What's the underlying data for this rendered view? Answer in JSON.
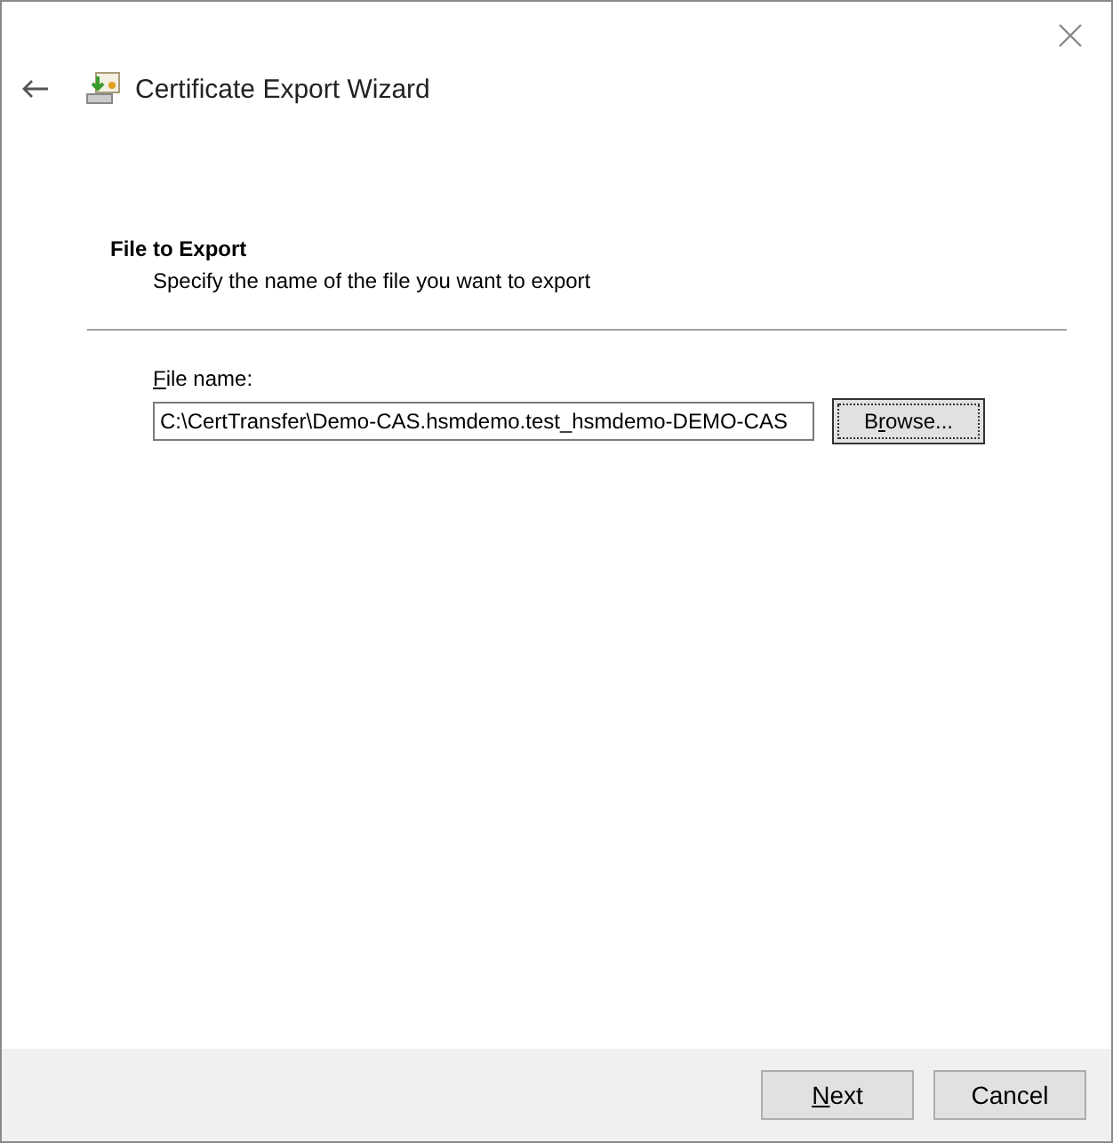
{
  "window": {
    "title": "Certificate Export Wizard"
  },
  "page": {
    "heading": "File to Export",
    "description": "Specify the name of the file you want to export"
  },
  "file_name": {
    "access_key": "F",
    "label_rest": "ile name:",
    "value": "C:\\CertTransfer\\Demo-CAS.hsmdemo.test_hsmdemo-DEMO-CAS"
  },
  "browse_button": {
    "label_start": "B",
    "access_key": "r",
    "label_rest": "owse...",
    "focused": true
  },
  "buttons": [
    {
      "access_key": "N",
      "label_rest": "ext"
    },
    {
      "label_rest": "Cancel"
    }
  ]
}
